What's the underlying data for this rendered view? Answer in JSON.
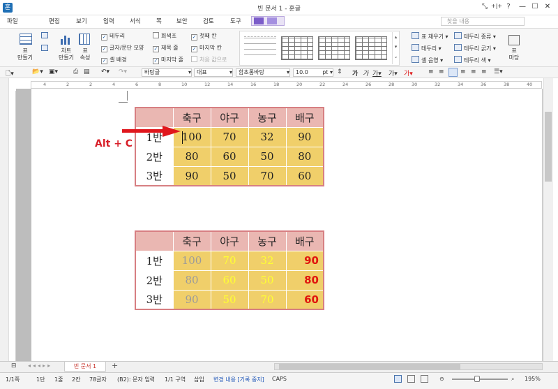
{
  "window": {
    "title": "빈 문서 1 - 훈글",
    "controls": [
      "⤡",
      "+|+",
      "?",
      "—",
      "☐",
      "✕"
    ]
  },
  "menu": {
    "items": [
      "파일",
      "편집",
      "보기",
      "입력",
      "서식",
      "쪽",
      "보안",
      "검토",
      "도구"
    ],
    "search_placeholder": "찾을 내용"
  },
  "ribbon": {
    "table_make": "표\n만들기",
    "chart_make": "차트\n만들기",
    "table_props": "표\n속성",
    "checks": [
      {
        "label": "테두리",
        "checked": true
      },
      {
        "label": "글자/문단 모양",
        "checked": true
      },
      {
        "label": "셀 배경",
        "checked": true
      },
      {
        "label": "회색조",
        "checked": false
      },
      {
        "label": "제목 줄",
        "checked": true
      },
      {
        "label": "마지막 줄",
        "checked": true
      },
      {
        "label": "첫째 칸",
        "checked": true
      },
      {
        "label": "마지막 칸",
        "checked": true
      },
      {
        "label": "처음 값으로",
        "checked": false,
        "disabled": true
      }
    ],
    "right_buttons": [
      "표 채우기",
      "테두리",
      "셀 음영",
      "테두리 종류",
      "테두리 굵기",
      "테두리 색"
    ],
    "margin_label": "표\n마당"
  },
  "format_toolbar": {
    "style": "바탕글",
    "lang": "대표",
    "font": "함초롬바탕",
    "size": "10.0",
    "unit": "pt"
  },
  "ruler_marks": [
    "4",
    "2",
    "2",
    "4",
    "6",
    "8",
    "10",
    "12",
    "14",
    "16",
    "18",
    "20",
    "22",
    "24",
    "26",
    "28",
    "30",
    "32",
    "34",
    "36",
    "38",
    "40"
  ],
  "table1": {
    "headers": [
      "축구",
      "야구",
      "농구",
      "배구"
    ],
    "rows": [
      {
        "label": "1반",
        "values": [
          "100",
          "70",
          "32",
          "90"
        ]
      },
      {
        "label": "2반",
        "values": [
          "80",
          "60",
          "50",
          "80"
        ]
      },
      {
        "label": "3반",
        "values": [
          "90",
          "50",
          "70",
          "60"
        ]
      }
    ]
  },
  "table2": {
    "headers": [
      "축구",
      "야구",
      "농구",
      "배구"
    ],
    "rows": [
      {
        "label": "1반",
        "values": [
          "100",
          "70",
          "32",
          "90"
        ]
      },
      {
        "label": "2반",
        "values": [
          "80",
          "60",
          "50",
          "80"
        ]
      },
      {
        "label": "3반",
        "values": [
          "90",
          "50",
          "70",
          "60"
        ]
      }
    ]
  },
  "annotation": {
    "shortcut": "Alt + C"
  },
  "doc_tab": "빈 문서 1",
  "status": {
    "page": "1/1쪽",
    "section": "1단",
    "line": "1줄",
    "col": "2칸",
    "chars": "78글자",
    "mode": "(B2): 문자 입력",
    "area": "1/1 구역",
    "insert": "삽입",
    "track": "변경 내용 [기록 중지]",
    "caps": "CAPS",
    "zoom": "195%"
  },
  "colors": {
    "header_bg": "#eab7b2",
    "cell_bg": "#f0cf6a",
    "border": "#d77f82",
    "grey_text": "#9a9a9a",
    "yellow_text": "#ffff33",
    "red_text": "#e0160e",
    "arrow": "#e0161c"
  }
}
